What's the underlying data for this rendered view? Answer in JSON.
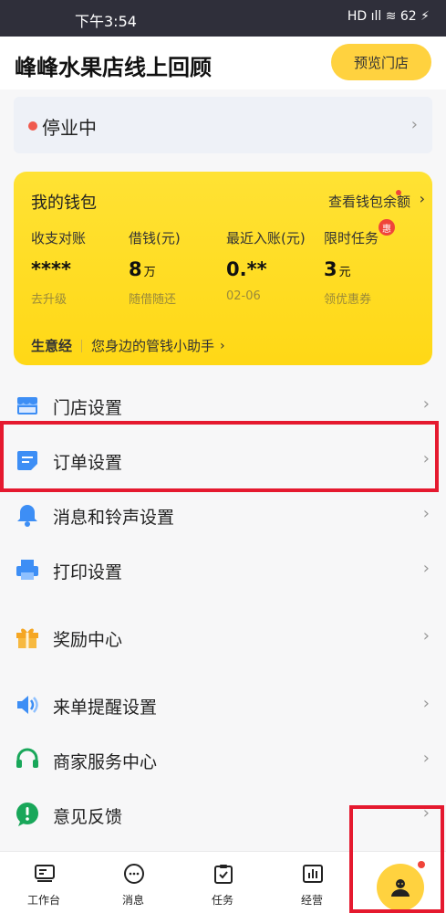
{
  "status_bar": {
    "time": "下午3:54",
    "tray": "HD ıll ≋ 62 ⚡"
  },
  "header": {
    "title": "峰峰水果店线上回顾",
    "preview_button": "预览门店"
  },
  "store_status": {
    "label": "停业中",
    "dot_color": "#f05a4e"
  },
  "wallet": {
    "title": "我的钱包",
    "balance_link": "查看钱包余额",
    "stats": [
      {
        "label": "收支对账",
        "value": "****",
        "unit": "",
        "sub": "去升级"
      },
      {
        "label": "借钱(元)",
        "value": "8",
        "unit": "万",
        "sub": "随借随还"
      },
      {
        "label": "最近入账(元)",
        "value": "0.**",
        "unit": "",
        "sub": "02-06"
      },
      {
        "label": "限时任务",
        "value": "3",
        "unit": "元",
        "sub": "领优惠券"
      }
    ],
    "task_badge": "惠",
    "bottom_title": "生意经",
    "bottom_text": "您身边的管钱小助手"
  },
  "menu": [
    {
      "label": "门店设置",
      "icon": "store-icon"
    },
    {
      "label": "订单设置",
      "icon": "order-icon"
    },
    {
      "label": "消息和铃声设置",
      "icon": "bell-icon"
    },
    {
      "label": "打印设置",
      "icon": "printer-icon"
    },
    {
      "label": "奖励中心",
      "icon": "gift-icon"
    },
    {
      "label": "来单提醒设置",
      "icon": "speaker-icon"
    },
    {
      "label": "商家服务中心",
      "icon": "headset-icon"
    },
    {
      "label": "意见反馈",
      "icon": "feedback-icon"
    }
  ],
  "tabbar": {
    "tabs": [
      {
        "label": "工作台",
        "icon": "desk-icon"
      },
      {
        "label": "消息",
        "icon": "chat-icon"
      },
      {
        "label": "任务",
        "icon": "task-icon"
      },
      {
        "label": "经营",
        "icon": "chart-icon"
      }
    ],
    "me_icon": "user-icon"
  },
  "colors": {
    "accent": "#ffd23f",
    "highlight": "#e5192f",
    "blue": "#3d8ef5",
    "green": "#19a75a"
  }
}
